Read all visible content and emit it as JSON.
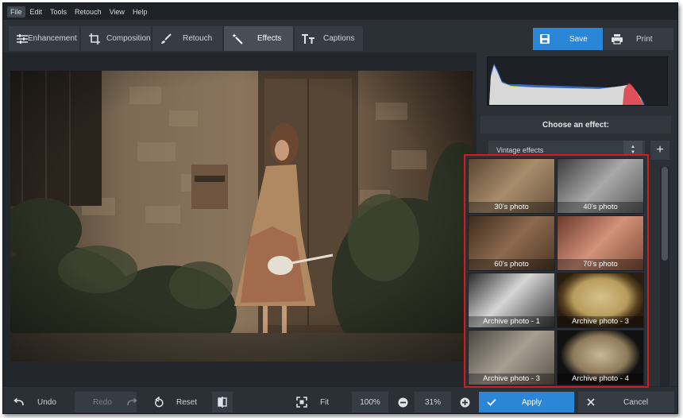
{
  "menu": [
    "File",
    "Edit",
    "Tools",
    "Retouch",
    "View",
    "Help"
  ],
  "tabs": [
    {
      "label": "Enhancement",
      "icon": "sliders-icon"
    },
    {
      "label": "Composition",
      "icon": "crop-icon"
    },
    {
      "label": "Retouch",
      "icon": "brush-icon"
    },
    {
      "label": "Effects",
      "icon": "magic-wand-icon"
    },
    {
      "label": "Captions",
      "icon": "text-icon"
    }
  ],
  "active_tab": "Effects",
  "actions": {
    "save": "Save",
    "print": "Print"
  },
  "panel": {
    "choose_label": "Choose an effect:",
    "category": "Vintage effects",
    "add_label": "+"
  },
  "effects": [
    {
      "label": "30's photo"
    },
    {
      "label": "40's photo"
    },
    {
      "label": "60's photo"
    },
    {
      "label": "70's photo"
    },
    {
      "label": "Archive photo - 1"
    },
    {
      "label": "Archive photo - 3"
    },
    {
      "label": "Archive photo - 3"
    },
    {
      "label": "Archive photo - 4"
    }
  ],
  "bottom": {
    "undo": "Undo",
    "redo": "Redo",
    "reset": "Reset",
    "fit": "Fit",
    "zoom_100": "100%",
    "zoom_level": "31%",
    "apply": "Apply",
    "cancel": "Cancel"
  },
  "colors": {
    "accent": "#2c86d8",
    "highlight_border": "#d91a1a",
    "background": "#2b3036"
  }
}
